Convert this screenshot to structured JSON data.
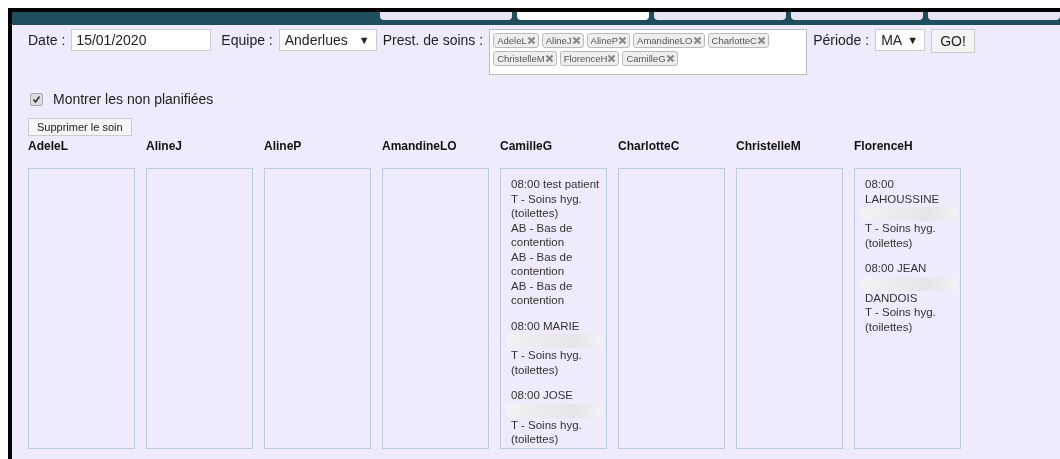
{
  "nav_tabs": [
    {
      "selected": false
    },
    {
      "selected": true
    },
    {
      "selected": false
    },
    {
      "selected": false
    },
    {
      "selected": false
    }
  ],
  "filters": {
    "date_label": "Date :",
    "date": "15/01/2020",
    "team_label": "Equipe :",
    "team": "Anderlues",
    "team_arrow": "▼",
    "caregivers_label": "Prest. de soins :",
    "caregivers": [
      "AdeleL",
      "AlineJ",
      "AlineP",
      "AmandineLO",
      "CharlotteC",
      "ChristelleM",
      "FlorenceH",
      "CamilleG"
    ],
    "period_label": "Période :",
    "period": "MA",
    "period_arrow": "▼",
    "go": "GO!"
  },
  "show_unplanned": {
    "label": "Montrer les non planifiées",
    "checked": true
  },
  "delete_button": "Supprimer le soin",
  "columns": [
    {
      "name": "AdeleL"
    },
    {
      "name": "AlineJ"
    },
    {
      "name": "AlineP"
    },
    {
      "name": "AmandineLO"
    },
    {
      "name": "CamilleG",
      "entries": [
        {
          "lines": [
            {
              "kind": "text",
              "text": "08:00 test patient"
            },
            {
              "kind": "text",
              "text": "T - Soins hyg. (toilettes)"
            },
            {
              "kind": "text",
              "text": "AB - Bas de contention"
            },
            {
              "kind": "text",
              "text": "AB - Bas de contention"
            },
            {
              "kind": "text",
              "text": "AB - Bas de contention"
            }
          ]
        },
        {
          "lines": [
            {
              "kind": "text",
              "text": "08:00 MARIE"
            },
            {
              "kind": "redacted"
            },
            {
              "kind": "text",
              "text": "T - Soins hyg. (toilettes)"
            }
          ]
        },
        {
          "lines": [
            {
              "kind": "text",
              "text": "08:00 JOSE"
            },
            {
              "kind": "redacted"
            },
            {
              "kind": "text",
              "text": "T - Soins hyg. (toilettes)"
            }
          ]
        }
      ]
    },
    {
      "name": "CharlotteC"
    },
    {
      "name": "ChristelleM"
    },
    {
      "name": "FlorenceH",
      "entries": [
        {
          "lines": [
            {
              "kind": "text",
              "text": "08:00 LAHOUSSINE"
            },
            {
              "kind": "redacted"
            },
            {
              "kind": "text",
              "text": "T - Soins hyg. (toilettes)"
            }
          ]
        },
        {
          "lines": [
            {
              "kind": "text",
              "text": "08:00 JEAN"
            },
            {
              "kind": "redacted"
            },
            {
              "kind": "text",
              "text": "DANDOIS"
            },
            {
              "kind": "text",
              "text": "T - Soins hyg. (toilettes)"
            }
          ]
        }
      ]
    }
  ]
}
